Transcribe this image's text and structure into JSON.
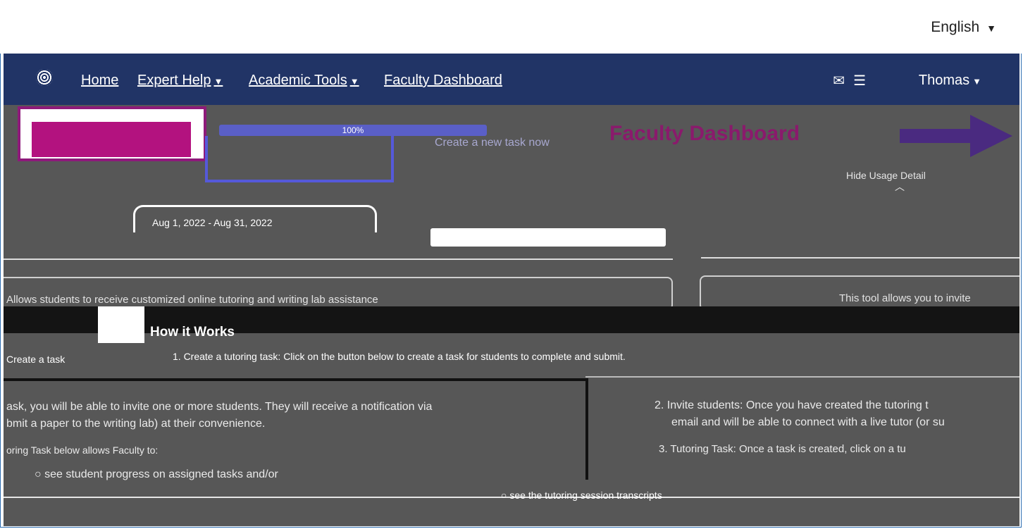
{
  "language": {
    "label": "English"
  },
  "nav": {
    "items": [
      {
        "label": "Home"
      },
      {
        "label": "Expert Help"
      },
      {
        "label": "Academic Tools"
      },
      {
        "label": "Faculty Dashboard"
      }
    ],
    "user": "Thomas",
    "mail_icon": "mail-icon",
    "tasks_icon": "task-list-icon"
  },
  "dashboard": {
    "title": "Faculty Dashboard",
    "progress_label": "100%",
    "create_link": "Create a new task now",
    "hide_usage": "Hide Usage Detail",
    "date_range": "Aug 1, 2022 - Aug 31, 2022",
    "card_left": "Allows students to receive customized online tutoring and writing lab assistance",
    "card_right": "This tool allows you to invite",
    "how_title": "How it Works",
    "step1_lead": "Create a task",
    "step1": "1. Create a tutoring task: Click on the button below to create a task for students to complete and submit.",
    "para1": "ask, you will be able to invite one or more students. They will receive a notification via",
    "para2": "bmit a paper to the writing lab) at their convenience.",
    "para3": "oring Task below allows Faculty to:",
    "bullet1": "see student progress on assigned tasks and/or",
    "bullet2": "see the tutoring session transcripts",
    "step2": "2. Invite students: Once you have created the tutoring t",
    "step2b": "email and will be able to connect with a live tutor (or su",
    "step3": "3. Tutoring Task: Once a task is created, click on a tu"
  }
}
